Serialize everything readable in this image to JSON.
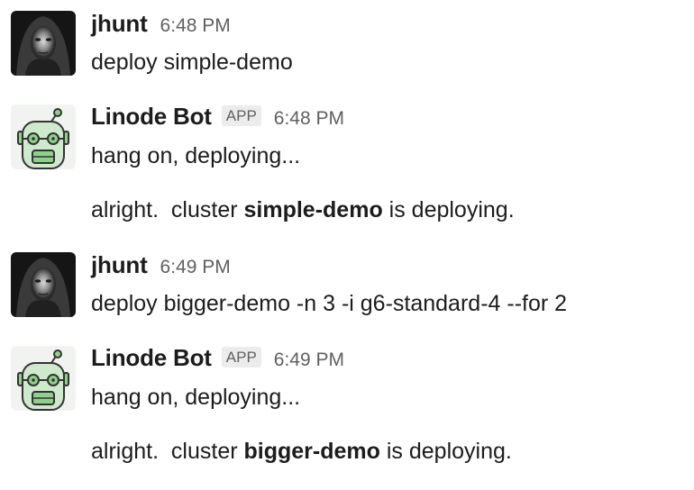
{
  "messages": [
    {
      "user": "jhunt",
      "time": "6:48 PM",
      "lines": [
        {
          "text": "deploy simple-demo"
        }
      ]
    },
    {
      "user": "Linode Bot",
      "badge": "APP",
      "time": "6:48 PM",
      "lines": [
        {
          "text": "hang on, deploying..."
        },
        {
          "before": "alright.  cluster ",
          "bold": "simple-demo",
          "after": " is deploying."
        }
      ]
    },
    {
      "user": "jhunt",
      "time": "6:49 PM",
      "lines": [
        {
          "text": "deploy bigger-demo -n 3 -i g6-standard-4 --for 2"
        }
      ]
    },
    {
      "user": "Linode Bot",
      "badge": "APP",
      "time": "6:49 PM",
      "lines": [
        {
          "text": "hang on, deploying..."
        },
        {
          "before": "alright.  cluster ",
          "bold": "bigger-demo",
          "after": " is deploying."
        }
      ]
    }
  ],
  "icons": {
    "user_avatar": "dark-hooded-face-avatar",
    "bot_avatar": "green-robot-avatar"
  },
  "colors": {
    "text": "#1d1c1d",
    "muted": "#616061",
    "robot_green": "#8fd18b"
  }
}
